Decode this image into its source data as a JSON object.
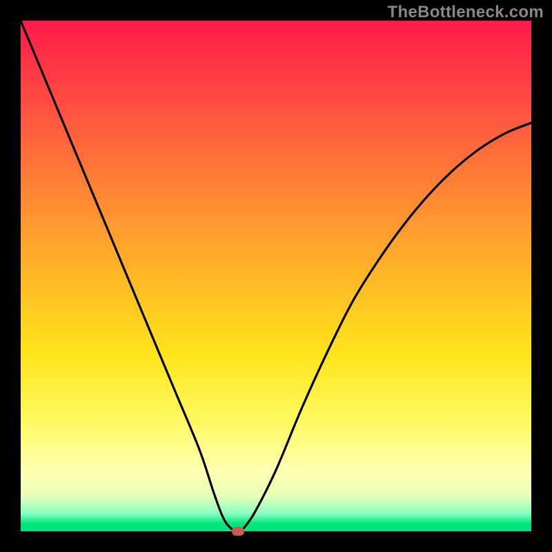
{
  "watermark": "TheBottleneck.com",
  "colors": {
    "frame": "#000000",
    "curve": "#000000",
    "marker": "#c65b54"
  },
  "chart_data": {
    "type": "line",
    "title": "",
    "xlabel": "",
    "ylabel": "",
    "xlim": [
      0,
      100
    ],
    "ylim": [
      0,
      100
    ],
    "x": [
      0,
      5,
      10,
      15,
      20,
      25,
      30,
      35,
      38,
      40,
      42,
      43,
      44,
      46,
      50,
      55,
      60,
      65,
      70,
      75,
      80,
      85,
      90,
      95,
      100
    ],
    "y": [
      100,
      88,
      76,
      64,
      52,
      40,
      28,
      16,
      7,
      2,
      0,
      0,
      1,
      4,
      12,
      24,
      35,
      45,
      53,
      60,
      66,
      71,
      75,
      78,
      80
    ],
    "marker": {
      "x": 42.5,
      "y": 0
    },
    "notes": "V-shaped bottleneck curve on rainbow gradient background with green band at y≈0. Values estimated from pixel positions; no axis ticks or labels present."
  }
}
